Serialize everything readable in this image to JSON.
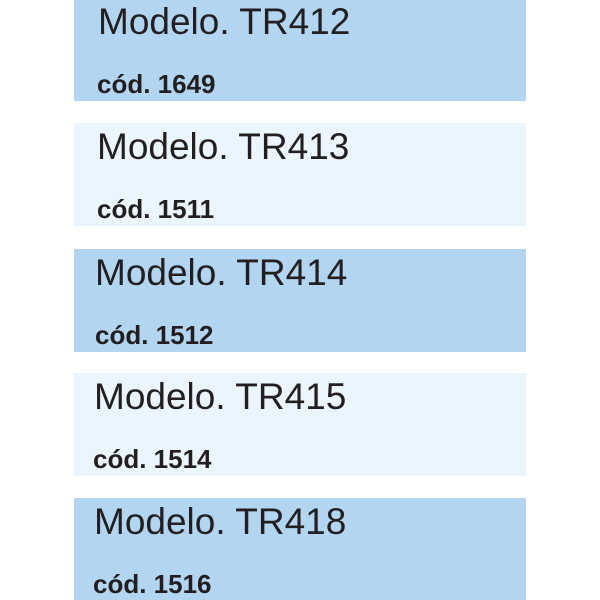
{
  "products": [
    {
      "model": "Modelo. TR412",
      "code": "cód. 1649",
      "shade": "dark"
    },
    {
      "model": "Modelo. TR413",
      "code": "cód. 1511",
      "shade": "light"
    },
    {
      "model": "Modelo. TR414",
      "code": "cód. 1512",
      "shade": "dark"
    },
    {
      "model": "Modelo. TR415",
      "code": "cód. 1514",
      "shade": "light"
    },
    {
      "model": "Modelo. TR418",
      "code": "cód. 1516",
      "shade": "dark"
    }
  ],
  "colors": {
    "dark_row": "#b2d5f2",
    "light_row": "#ebf5fd",
    "text": "#231f20"
  }
}
